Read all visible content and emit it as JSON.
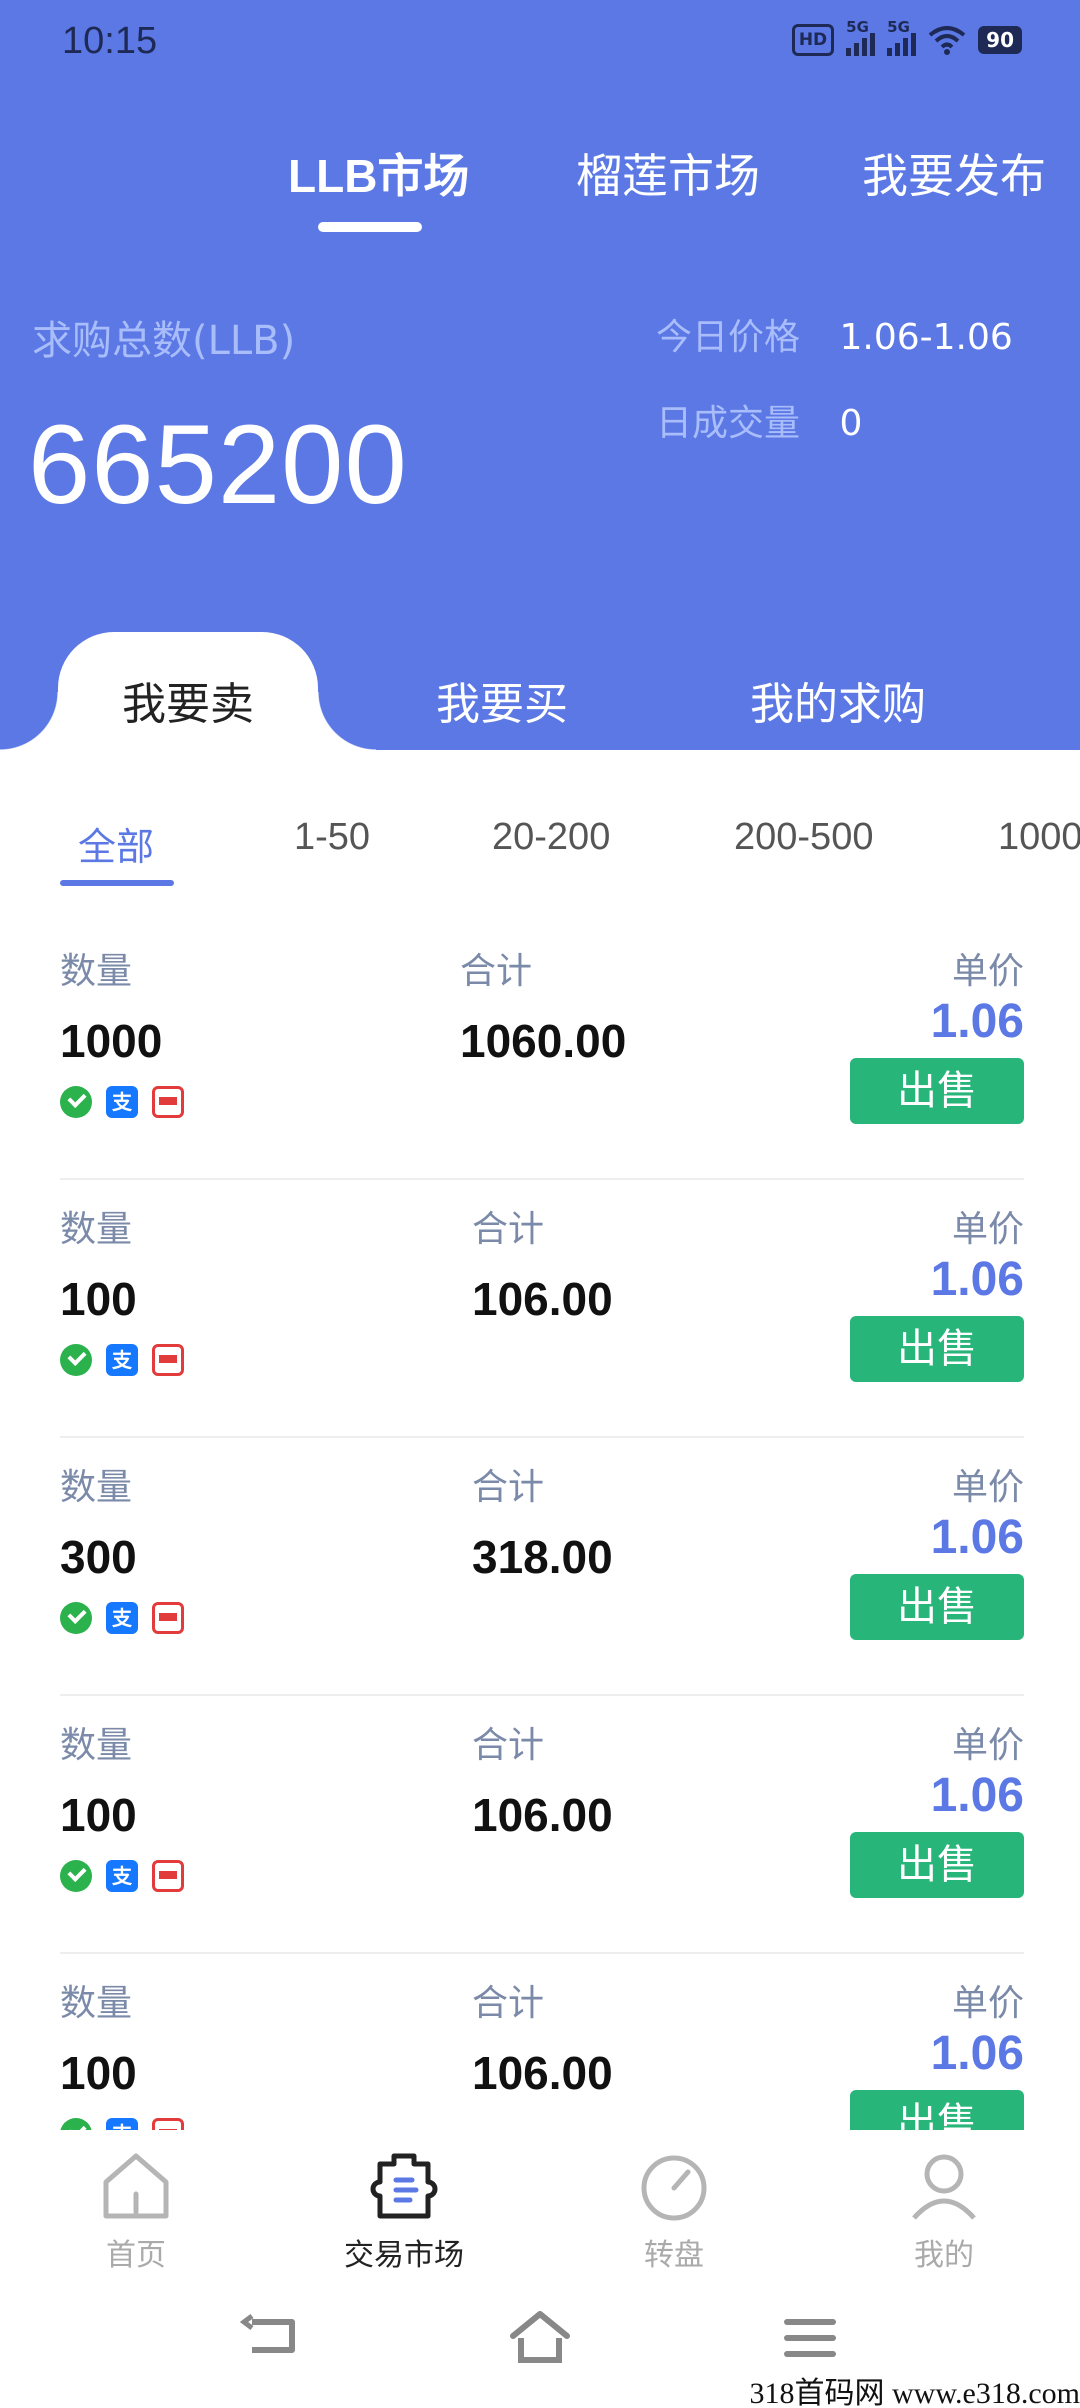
{
  "status_bar": {
    "time": "10:15",
    "network_1": "5G",
    "network_2": "5G",
    "hd_label": "HD",
    "battery": "90"
  },
  "top_tabs": [
    {
      "label": "LLB市场",
      "active": true
    },
    {
      "label": "榴莲市场",
      "active": false
    },
    {
      "label": "我要发布",
      "active": false
    }
  ],
  "stats": {
    "total_label": "求购总数(LLB)",
    "total_value": "665200",
    "price_label": "今日价格",
    "price_value": "1.06-1.06",
    "volume_label": "日成交量",
    "volume_value": "0"
  },
  "segments": [
    {
      "label": "我要卖",
      "active": true
    },
    {
      "label": "我要买",
      "active": false
    },
    {
      "label": "我的求购",
      "active": false
    }
  ],
  "filters": [
    {
      "label": "全部",
      "active": true
    },
    {
      "label": "1-50",
      "active": false
    },
    {
      "label": "20-200",
      "active": false
    },
    {
      "label": "200-500",
      "active": false
    },
    {
      "label": "1000",
      "active": false
    }
  ],
  "order_labels": {
    "quantity": "数量",
    "total": "合计",
    "unit_price": "单价",
    "sell_button": "出售",
    "alipay_glyph": "支"
  },
  "orders": [
    {
      "quantity": "1000",
      "total": "1060.00",
      "price": "1.06"
    },
    {
      "quantity": "100",
      "total": "106.00",
      "price": "1.06"
    },
    {
      "quantity": "300",
      "total": "318.00",
      "price": "1.06"
    },
    {
      "quantity": "100",
      "total": "106.00",
      "price": "1.06"
    },
    {
      "quantity": "100",
      "total": "106.00",
      "price": "1.06"
    }
  ],
  "bottom_nav": [
    {
      "label": "首页",
      "icon": "home-icon",
      "active": false
    },
    {
      "label": "交易市场",
      "icon": "market-icon",
      "active": true
    },
    {
      "label": "转盘",
      "icon": "dial-icon",
      "active": false
    },
    {
      "label": "我的",
      "icon": "profile-icon",
      "active": false
    }
  ],
  "watermark": "318首码网  www.e318.com",
  "colors": {
    "primary": "#5b78e5",
    "sell_button": "#27b57a",
    "label_light": "#a9bdfb"
  }
}
